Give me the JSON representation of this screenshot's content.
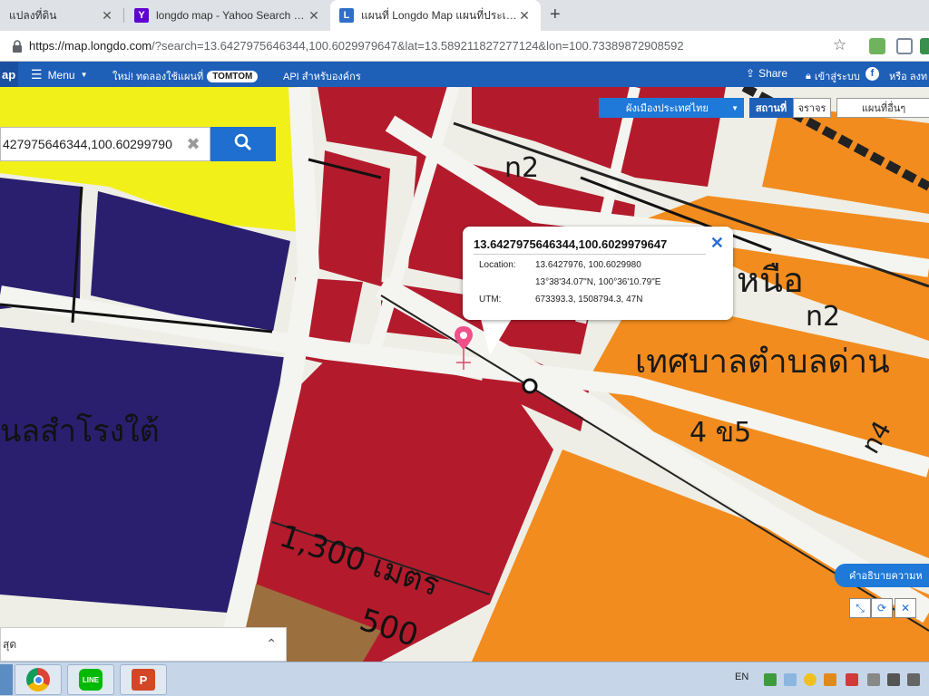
{
  "browser": {
    "tabs": [
      {
        "label": "แปลงที่ดิน",
        "favicon": "page-icon"
      },
      {
        "label": "longdo map - Yahoo Search Res",
        "favicon": "yahoo-icon"
      },
      {
        "label": "แผนที่ Longdo Map แผนที่ประเทศไ",
        "favicon": "longdo-icon",
        "active": true
      }
    ],
    "new_tab_symbol": "+",
    "url_host": "https://map.longdo.com",
    "url_path": "/?search=13.6427975646344,100.6029979647&lat=13.5892118272771​24&lon=100.73389872908592"
  },
  "topnav": {
    "logo_text": "ap",
    "menu_label": "Menu",
    "promo_text": "ใหม่! ทดลองใช้แผนที่",
    "tomtom_label": "TOMTOM",
    "api_link": "API สำหรับองค์กร",
    "share_label": "Share",
    "login_label": "เข้าสู่ระบบ",
    "or_label": "หรือ ลงท"
  },
  "search": {
    "value": "427975646344,100.60299790",
    "clear_symbol": "✖"
  },
  "layers": {
    "zoning_label": "ผังเมืองประเทศไทย",
    "place_label": "สถานที่",
    "traffic_label": "จราจร",
    "other_label": "แผนที่อื่นๆ"
  },
  "popup": {
    "title": "13.6427975646344,100.6029979647",
    "close_symbol": "✕",
    "location_label": "Location:",
    "location_decimal": "13.6427976, 100.6029980",
    "location_dms": "13°38'34.07\"N, 100°36'10.79\"E",
    "utm_label": "UTM:",
    "utm_value": "673393.3, 1508794.3, 47N"
  },
  "map_labels": {
    "distance_1300": "1,300 เมตร",
    "distance_500": "500",
    "municipality": "เทศบาลตำบลด่าน",
    "n2_a": "n2",
    "n2_b": "n2",
    "n4": "n4",
    "village": "นลสำโรงใต้",
    "zone_4_5": "4 ข5",
    "north_label": "หนือ"
  },
  "legend_button": "คำอธิบายความห",
  "resultbar": {
    "text": "สุด"
  },
  "taskbar": {
    "lang": "EN"
  },
  "colors": {
    "zone_red": "#b31b2c",
    "zone_orange": "#f28c1e",
    "zone_navy": "#2a1f6e",
    "zone_yellow": "#f2f019",
    "zone_brown": "#9c6f3e",
    "brand_blue": "#1e5fb8"
  }
}
